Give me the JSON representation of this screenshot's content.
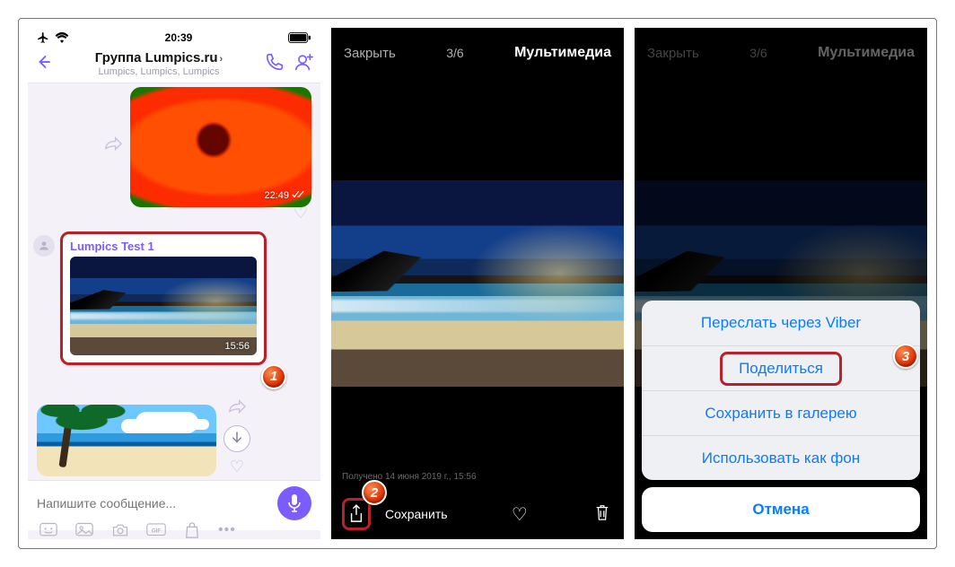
{
  "screen1": {
    "status": {
      "time": "20:39"
    },
    "header": {
      "title": "Группа Lumpics.ru",
      "members": "Lumpics, Lumpics, Lumpics"
    },
    "messages": {
      "flower_time": "22:49",
      "sender_name": "Lumpics Test 1",
      "beach_time": "15:56"
    },
    "input_placeholder": "Напишите сообщение...",
    "toolbar": {
      "gif_label": "GIF"
    }
  },
  "screen2": {
    "close": "Закрыть",
    "counter": "3/6",
    "title": "Мультимедиа",
    "caption": "Получено 14 июня 2019 г., 15:56",
    "save": "Сохранить"
  },
  "screen3": {
    "close": "Закрыть",
    "counter": "3/6",
    "title": "Мультимедиа",
    "sheet": {
      "forward": "Переслать через Viber",
      "share": "Поделиться",
      "save_gallery": "Сохранить в галерею",
      "wallpaper": "Использовать как фон",
      "cancel": "Отмена"
    }
  },
  "badges": {
    "one": "1",
    "two": "2",
    "three": "3"
  }
}
